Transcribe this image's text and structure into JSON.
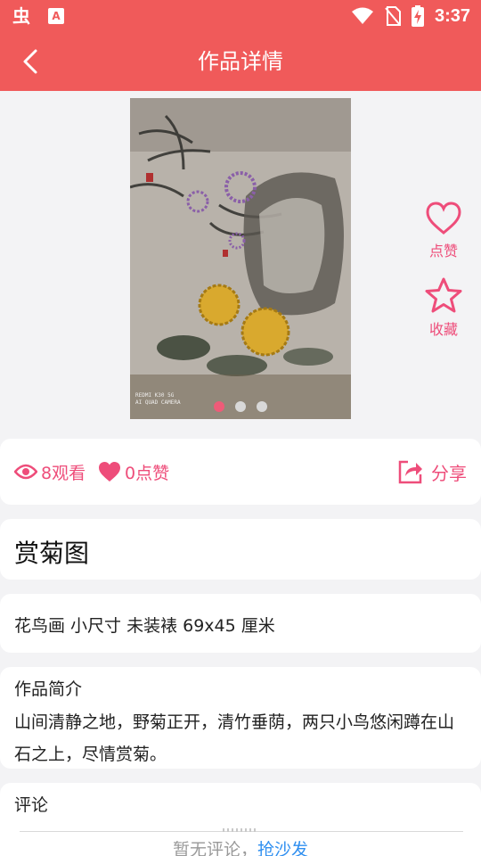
{
  "status_bar": {
    "app_icon_1": "虫",
    "app_icon_2": "A",
    "time": "3:37",
    "icons": [
      "wifi-icon",
      "no-sim-icon",
      "battery-charging-icon"
    ]
  },
  "header": {
    "title": "作品详情",
    "back_icon": "chevron-left-icon"
  },
  "gallery": {
    "camera_mark_line1": "REDMI K30 5G",
    "camera_mark_line2": "AI QUAD CAMERA",
    "slide_count": 3,
    "active_index": 0
  },
  "side_actions": {
    "like_label": "点赞",
    "favorite_label": "收藏"
  },
  "stats": {
    "views": "8观看",
    "likes": "0点赞",
    "share_label": "分享"
  },
  "work": {
    "title": "赏菊图",
    "spec": "花鸟画 小尺寸 未装裱 69x45 厘米",
    "intro_heading": "作品简介",
    "intro_text": "山间清静之地，野菊正开，清竹垂荫，两只小鸟悠闲蹲在山石之上，尽情赏菊。"
  },
  "comments": {
    "heading": "评论",
    "empty_text": "暂无评论，",
    "sofa_link": "抢沙发"
  },
  "colors": {
    "brand": "#f05a5a",
    "accent_pink": "#ee4d7a",
    "link_blue": "#2f8ff0"
  }
}
